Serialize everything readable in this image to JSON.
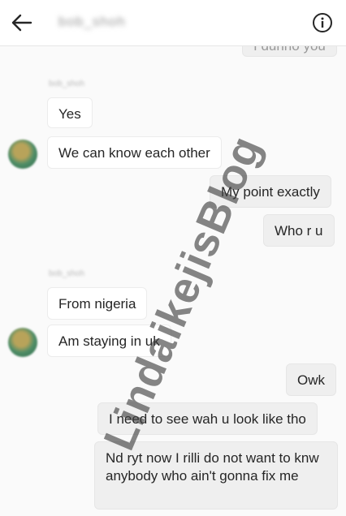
{
  "header": {
    "contact_name": "bob_shoh"
  },
  "messages": [
    {
      "id": "m0",
      "side": "out",
      "text": "I dunno you"
    },
    {
      "id": "m1",
      "side": "in",
      "sender": "bob_shoh",
      "text": "Yes"
    },
    {
      "id": "m2",
      "side": "in",
      "text": "We can know each other"
    },
    {
      "id": "m3",
      "side": "out",
      "text": "My point exactly"
    },
    {
      "id": "m4",
      "side": "out",
      "text": "Who r u"
    },
    {
      "id": "m5",
      "side": "in",
      "sender": "bob_shoh",
      "text": "From nigeria"
    },
    {
      "id": "m6",
      "side": "in",
      "text": "Am staying in uk"
    },
    {
      "id": "m7",
      "side": "out",
      "text": "Owk"
    },
    {
      "id": "m8",
      "side": "out",
      "text": "I need to see wah u look like tho"
    },
    {
      "id": "m9",
      "side": "out",
      "text": "Nd ryt now I rilli do not want to knw anybody who ain't gonna fix me"
    }
  ],
  "watermark": "LindaikejisBlog",
  "colors": {
    "background": "#fafafa",
    "outgoing_bubble": "#efefef",
    "incoming_bubble": "#ffffff"
  }
}
